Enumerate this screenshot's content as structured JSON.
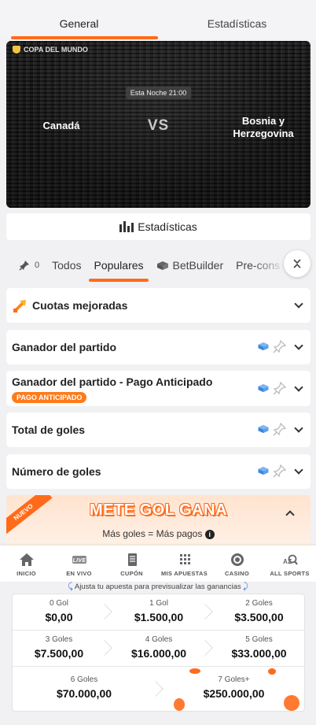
{
  "top_tabs": [
    "General",
    "Estadísticas"
  ],
  "hero": {
    "competition": "COPA DEL MUNDO",
    "time": "Esta Noche 21:00",
    "home_team": "Canadá",
    "vs": "VS",
    "away_team": "Bosnia y Herzegovina"
  },
  "stats_button": "Estadísticas",
  "filters": {
    "pin_count": "0",
    "items": [
      "Todos",
      "Populares",
      "BetBuilder",
      "Pre-cons"
    ],
    "active": "Populares"
  },
  "markets": [
    {
      "title": "Cuotas mejoradas"
    },
    {
      "title": "Ganador del partido"
    },
    {
      "title": "Ganador del partido - Pago Anticipado",
      "badge": "PAGO ANTICIPADO"
    },
    {
      "title": "Total de goles"
    },
    {
      "title": "Número de goles"
    }
  ],
  "promo": {
    "ribbon": "NUEVO",
    "title": "METE GOL GANA",
    "subtitle": "Más goles = Más pagos",
    "info": "i"
  },
  "bottom_nav": [
    {
      "label": "INICIO",
      "icon": "home-icon"
    },
    {
      "label": "EN VIVO",
      "icon": "live-icon",
      "icon_text": "LIVE"
    },
    {
      "label": "CUPÓN",
      "icon": "coupon-icon"
    },
    {
      "label": "MIS APUESTAS",
      "icon": "grid-icon"
    },
    {
      "label": "CASINO",
      "icon": "casino-chip-icon"
    },
    {
      "label": "ALL SPORTS",
      "icon": "az-search-icon",
      "icon_text": "AZ"
    }
  ],
  "payout_hint": "Ajusta tu apuesta para previsualizar las ganancias",
  "payouts": [
    {
      "label": "0 Gol",
      "value": "$0,00"
    },
    {
      "label": "1 Gol",
      "value": "$1.500,00"
    },
    {
      "label": "2 Goles",
      "value": "$3.500,00"
    },
    {
      "label": "3 Goles",
      "value": "$7.500,00"
    },
    {
      "label": "4 Goles",
      "value": "$16.000,00"
    },
    {
      "label": "5 Goles",
      "value": "$33.000,00"
    },
    {
      "label": "6 Goles",
      "value": "$70.000,00"
    },
    {
      "label": "7 Goles+",
      "value": "$250.000,00"
    }
  ],
  "colors": {
    "accent": "#ff6b1a",
    "betbuilder_blue": "#3a86e0",
    "badge_orange": "#ff7a1a"
  }
}
